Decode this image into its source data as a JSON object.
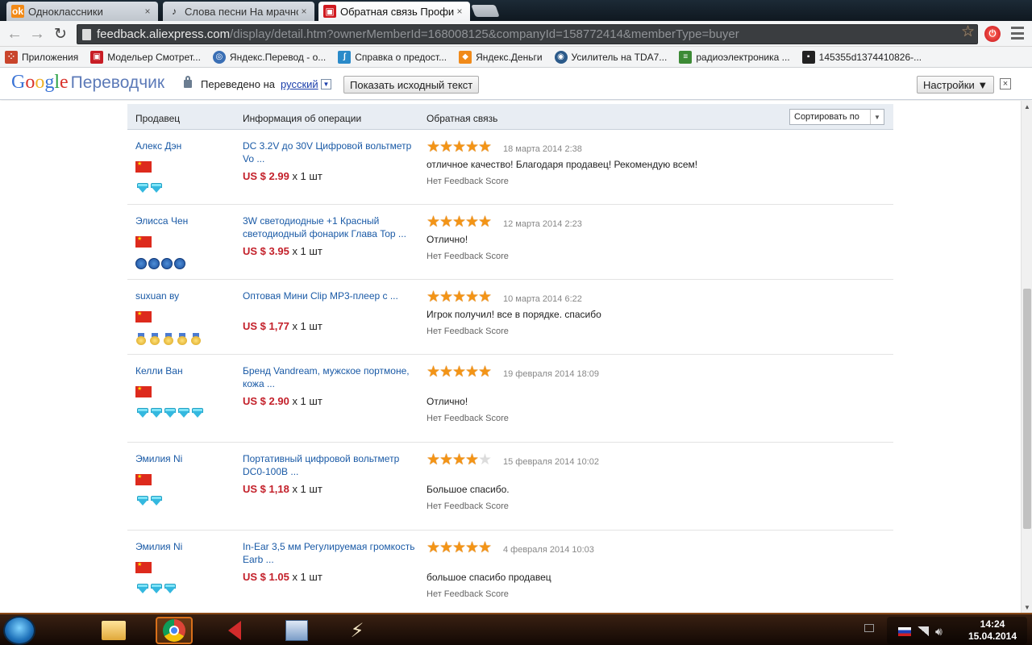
{
  "browser": {
    "tabs": [
      {
        "title": "Одноклассники",
        "close": "×",
        "favicon": "odnoklassniki-icon",
        "fav_color": "#f28a16",
        "fav_char": "ok"
      },
      {
        "title": "Слова песни На мрачной",
        "close": "×",
        "favicon": "music-note-icon",
        "fav_color": "#444444",
        "fav_char": "♪"
      },
      {
        "title": "Обратная связь Профиль",
        "close": "×",
        "favicon": "aliexpress-cart-icon",
        "fav_color": "#d0191f",
        "fav_char": "▣"
      }
    ],
    "url_host": "feedback.aliexpress.com",
    "url_path": "/display/detail.htm?ownerMemberId=168008125&companyId=158772414&memberType=buyer",
    "bookmarks": [
      {
        "label": "Приложения",
        "icon": "apps-grid-icon",
        "color": "#c9452c"
      },
      {
        "label": "Модельер Смотрет...",
        "icon": "cart-icon",
        "color": "#c81d25"
      },
      {
        "label": "Яндекс.Перевод - о...",
        "icon": "globe-icon",
        "color": "#3a6fb5"
      },
      {
        "label": "Справка о предост...",
        "icon": "help-icon",
        "color": "#2a8ac9"
      },
      {
        "label": "Яндекс.Деньги",
        "icon": "wallet-icon",
        "color": "#f08a1a"
      },
      {
        "label": "Усилитель на TDA7...",
        "icon": "circuit-icon",
        "color": "#2b5a8a"
      },
      {
        "label": "радиоэлектроника ...",
        "icon": "books-icon",
        "color": "#3c8a35"
      },
      {
        "label": "145355d1374410826-...",
        "icon": "image-icon",
        "color": "#222222"
      }
    ]
  },
  "translate_bar": {
    "logo_google": [
      "G",
      "o",
      "o",
      "g",
      "l",
      "e"
    ],
    "logo_product": "Переводчик",
    "translated_to": "Переведено на",
    "language": "русский",
    "lang_arrow": "▼",
    "show_original": "Показать исходный текст",
    "settings": "Настройки ▼",
    "close": "×"
  },
  "table": {
    "headers": {
      "seller": "Продавец",
      "operation": "Информация об операции",
      "feedback": "Обратная связь"
    },
    "sort_label": "Сортировать по",
    "sort_arrow": "▼",
    "rows": [
      {
        "seller": "Алекс Дэн",
        "badge_type": "diamond",
        "badge_count": 2,
        "product": "DC 3.2V до 30V Цифровой вольтметр Vo ...",
        "price": "US $ 2.99",
        "qty": " x 1 шт",
        "rating": 5,
        "date": "18 марта 2014 2:38",
        "comment": "отличное качество! Благодаря продавец! Рекомендую всем!",
        "score": "Нет Feedback Score"
      },
      {
        "seller": "Элисса Чен",
        "badge_type": "crown",
        "badge_count": 4,
        "product": "3W светодиодные +1 Красный светодиодный фонарик Глава Top ...",
        "price": "US $ 3.95",
        "qty": " x 1 шт",
        "rating": 5,
        "date": "12 марта 2014 2:23",
        "comment": "Отлично!",
        "score": "Нет Feedback Score"
      },
      {
        "seller": "suxuan ву",
        "badge_type": "medal",
        "badge_count": 5,
        "product": "Оптовая Мини Clip MP3-плеер с ...",
        "price": "US $ 1,77",
        "qty": " x 1 шт",
        "rating": 5,
        "date": "10 марта 2014 6:22",
        "comment": "Игрок получил! все в порядке. спасибо",
        "score": "Нет Feedback Score"
      },
      {
        "seller": "Келли Ван",
        "badge_type": "diamond",
        "badge_count": 5,
        "product": "Бренд Vandream, мужское портмоне, кожа ...",
        "price": "US $ 2.90",
        "qty": " x 1 шт",
        "rating": 5,
        "date": "19 февраля 2014 18:09",
        "comment": "Отлично!",
        "score": "Нет Feedback Score"
      },
      {
        "seller": "Эмилия Ni",
        "badge_type": "diamond",
        "badge_count": 2,
        "product": "Портативный цифровой вольтметр DC0-100B ...",
        "price": "US $ 1,18",
        "qty": " x 1 шт",
        "rating": 4,
        "date": "15 февраля 2014 10:02",
        "comment": "Большое спасибо.",
        "score": "Нет Feedback Score"
      },
      {
        "seller": "Эмилия Ni",
        "badge_type": "diamond",
        "badge_count": 3,
        "product": "In-Ear 3,5 мм Регулируемая громкость Earb ...",
        "price": "US $ 1.05",
        "qty": " x 1 шт",
        "rating": 5,
        "date": "4 февраля 2014 10:03",
        "comment": "большое спасибо продавец",
        "score": "Нет Feedback Score"
      }
    ]
  },
  "taskbar": {
    "apps": [
      {
        "name": "explorer",
        "icon": "folder-icon"
      },
      {
        "name": "chrome",
        "icon": "chrome-icon",
        "active": true
      },
      {
        "name": "audio",
        "icon": "speaker-icon"
      },
      {
        "name": "installer",
        "icon": "box-icon"
      },
      {
        "name": "winamp",
        "icon": "bolt-icon"
      }
    ],
    "time": "14:24",
    "date": "15.04.2014"
  }
}
